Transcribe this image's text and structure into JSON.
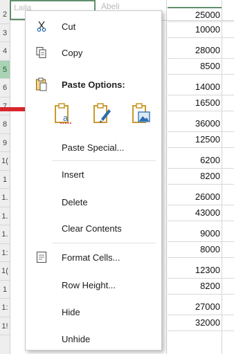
{
  "sheet": {
    "row_headers": [
      "2",
      "3",
      "4",
      "5",
      "6",
      "7",
      "8",
      "9",
      "1(",
      "1",
      "1.",
      "1.",
      "1.",
      "1:",
      "1(",
      "1",
      "1:",
      "1!"
    ],
    "selected_row_index": 3,
    "top_row_cells": [
      "Laila",
      "Abeli"
    ],
    "values": [
      "25000",
      "10000",
      "28000",
      "8500",
      "14000",
      "16500",
      "36000",
      "12500",
      "6200",
      "8200",
      "26000",
      "43000",
      "9000",
      "8000",
      "12300",
      "8200",
      "27000",
      "32000"
    ]
  },
  "menu": {
    "cut": "Cut",
    "copy": "Copy",
    "paste_options": "Paste Options:",
    "paste_special": "Paste Special...",
    "insert": "Insert",
    "delete": "Delete",
    "clear_contents": "Clear Contents",
    "format_cells": "Format Cells...",
    "row_height": "Row Height...",
    "hide": "Hide",
    "unhide": "Unhide"
  },
  "icons": {
    "cut": "scissors-icon",
    "copy": "copy-icon",
    "paste_header": "clipboard-icon",
    "paste_values": "paste-values-icon",
    "paste_formatting": "paste-formatting-icon",
    "paste_picture": "paste-picture-icon",
    "format_cells": "format-cells-icon"
  },
  "colors": {
    "selection_green": "#5f8f6c",
    "selected_row_header": "#a9d3b4",
    "arrow": "#d9262c",
    "clipboard_gold": "#c99a2e",
    "accent_blue": "#2b6cb0"
  }
}
